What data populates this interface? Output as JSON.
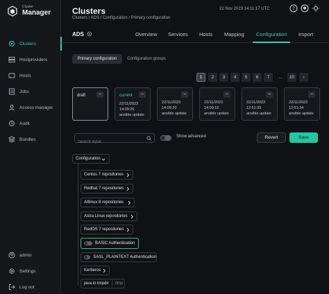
{
  "brand": {
    "small": "Cluster",
    "big": "Manager"
  },
  "sidebar": {
    "items": [
      {
        "label": "Clusters",
        "icon": "clusters-icon"
      },
      {
        "label": "Hostproviders",
        "icon": "hostproviders-icon"
      },
      {
        "label": "Hosts",
        "icon": "hosts-icon"
      },
      {
        "label": "Jobs",
        "icon": "jobs-icon"
      },
      {
        "label": "Access manager",
        "icon": "access-manager-icon"
      },
      {
        "label": "Audit",
        "icon": "audit-icon"
      },
      {
        "label": "Bundles",
        "icon": "bundles-icon"
      }
    ],
    "bottom": [
      {
        "label": "admin",
        "icon": "user-icon"
      },
      {
        "label": "Settings",
        "icon": "settings-icon"
      },
      {
        "label": "Log out",
        "icon": "logout-icon"
      }
    ]
  },
  "header": {
    "title": "Clusters",
    "breadcrumb": "Clusters / ADS / Configuration / Primary configuration",
    "datetime": "22 Nov 2023  14:11:17  UTC"
  },
  "entity": {
    "name": "ADS"
  },
  "tabs": [
    {
      "label": "Overview"
    },
    {
      "label": "Services"
    },
    {
      "label": "Hosts"
    },
    {
      "label": "Mapping"
    },
    {
      "label": "Configuration"
    },
    {
      "label": "Import"
    }
  ],
  "segments": {
    "primary": "Primary configuration",
    "groups": "Configuration groups"
  },
  "pagination": {
    "pages": [
      "1",
      "2",
      "3",
      "4",
      "5",
      "6",
      "7"
    ],
    "dots": "...",
    "last": "10",
    "next": "›"
  },
  "versions": [
    {
      "label": "draft",
      "date": "",
      "desc": ""
    },
    {
      "label": "current",
      "date": "22/11/2023 14:09:26",
      "desc": "ansible update"
    },
    {
      "label": "",
      "date": "22/11/2023 14:09:20",
      "desc": "ansible update"
    },
    {
      "label": "",
      "date": "22/11/2023 14:09:15",
      "desc": "ansible update"
    },
    {
      "label": "",
      "date": "22/11/2023 12:51:35",
      "desc": "ansible update"
    },
    {
      "label": "",
      "date": "22/11/2023 12:51:34",
      "desc": "ansible update"
    }
  ],
  "toolbar": {
    "search_placeholder": "Search input",
    "show_advanced": "Show advanced",
    "revert": "Revert",
    "save": "Save"
  },
  "tree": {
    "root": "Configuration",
    "nodes": [
      {
        "label": "Centos 7 repositories",
        "kind": "group"
      },
      {
        "label": "Redhat 7 repositories",
        "kind": "group"
      },
      {
        "label": "Altlinux 8 repositories",
        "kind": "group"
      },
      {
        "label": "Astra Linux repositories",
        "kind": "group"
      },
      {
        "label": "RedOS 7 repositories",
        "kind": "group"
      },
      {
        "label": "BASIC Authentication",
        "kind": "toggle"
      },
      {
        "label": "SASL_PLAINTEXT Authentication",
        "kind": "toggle"
      },
      {
        "label": "Kerberos",
        "kind": "group"
      },
      {
        "label": "java.io.tmpdir",
        "kind": "value",
        "value": "/tmp"
      }
    ]
  },
  "colors": {
    "accent": "#2fd6b4",
    "save": "#22c7a4",
    "highlight": "#2fc486",
    "background": "#101114"
  }
}
